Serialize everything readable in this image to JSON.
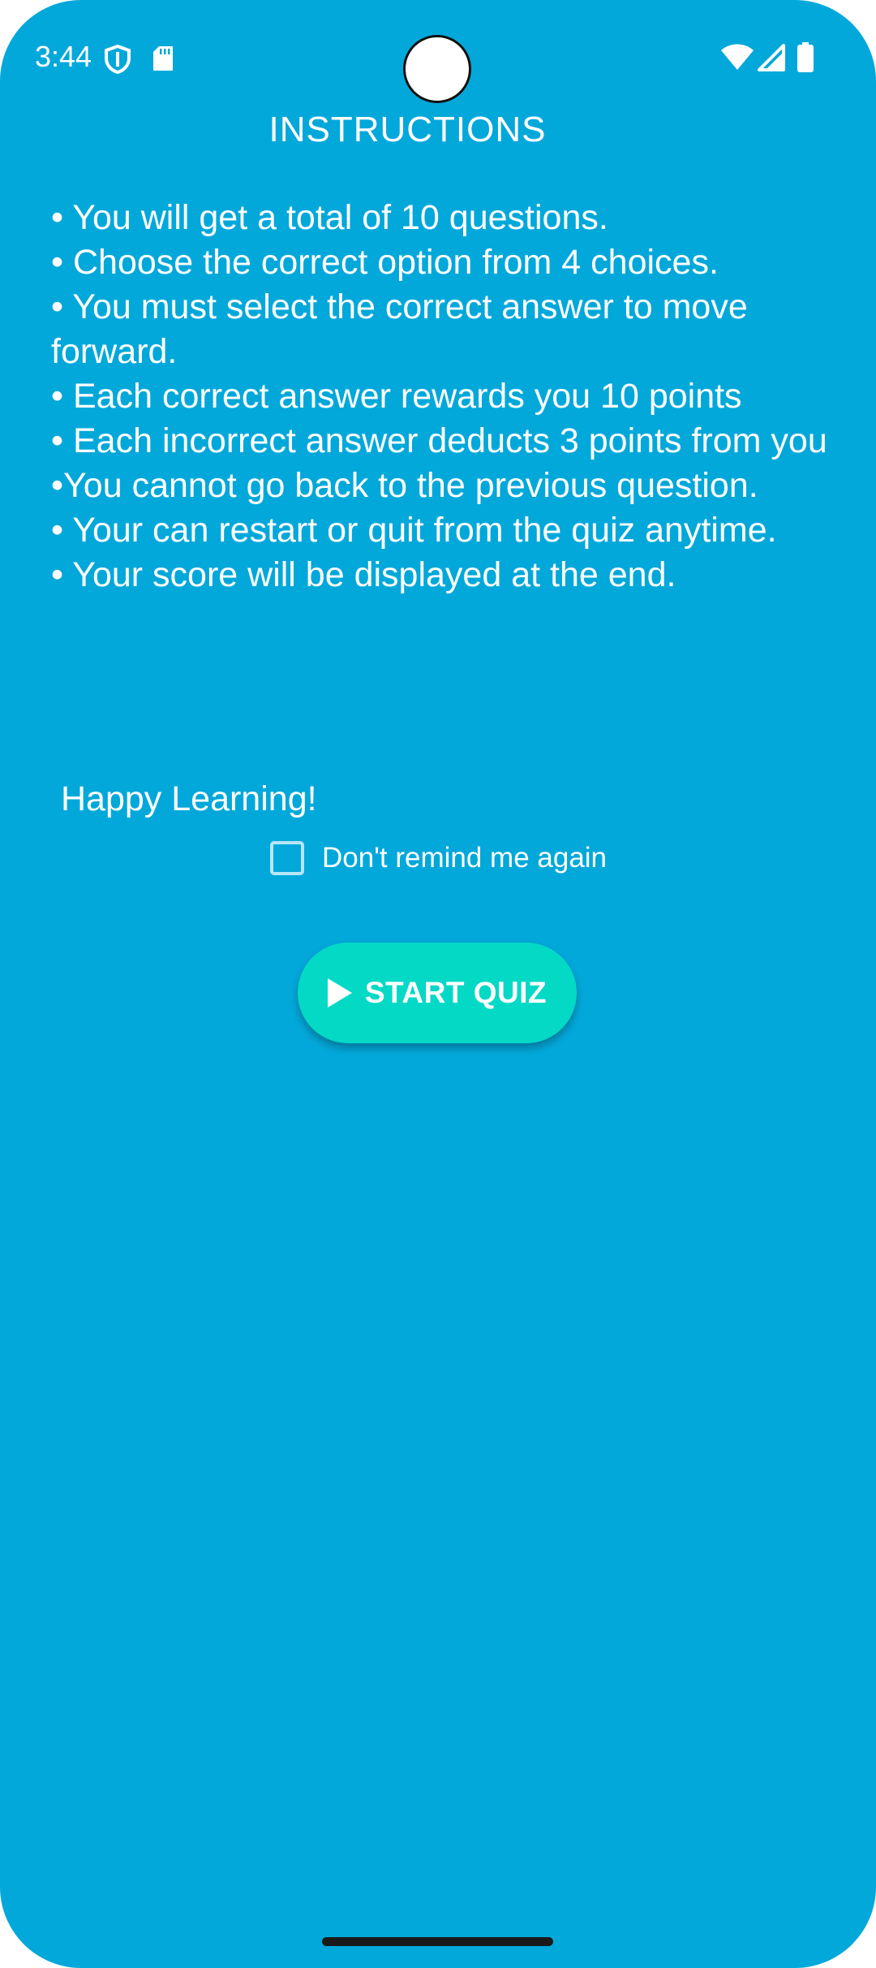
{
  "status_bar": {
    "time": "3:44",
    "icons": [
      "shield-icon",
      "sd-card-icon",
      "wifi-icon",
      "cellular-signal-icon",
      "battery-icon"
    ]
  },
  "screen": {
    "title": "INSTRUCTIONS",
    "instructions": [
      "• You will get a total of 10 questions.",
      "• Choose the correct option from 4 choices.",
      "• You must select the correct answer to move forward.",
      "• Each correct answer rewards you 10 points",
      "• Each incorrect answer deducts 3 points from you",
      "•You cannot go back to the previous question.",
      "• Your can restart or quit from the quiz anytime.",
      "• Your score will be displayed at the end."
    ],
    "closing": "Happy Learning!",
    "remind_checkbox": {
      "label": "Don't remind me again",
      "checked": false
    },
    "start_button": {
      "label": "START QUIZ",
      "icon": "play-icon"
    }
  },
  "colors": {
    "background": "#03a8da",
    "button": "#04d9c6",
    "text": "#ffffff"
  }
}
